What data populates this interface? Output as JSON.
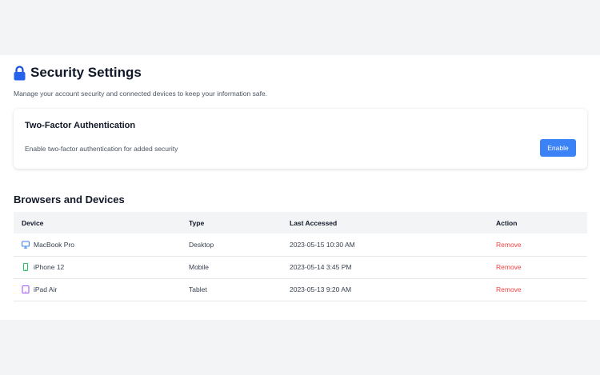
{
  "page": {
    "title": "Security Settings",
    "subtitle": "Manage your account security and connected devices to keep your information safe."
  },
  "two_factor": {
    "title": "Two-Factor Authentication",
    "description": "Enable two-factor authentication for added security",
    "button_label": "Enable"
  },
  "devices_section": {
    "title": "Browsers and Devices",
    "columns": [
      "Device",
      "Type",
      "Last Accessed",
      "Action"
    ],
    "rows": [
      {
        "device": "MacBook Pro",
        "icon": "desktop-icon",
        "type": "Desktop",
        "last_accessed": "2023-05-15 10:30 AM",
        "action": "Remove"
      },
      {
        "device": "iPhone 12",
        "icon": "mobile-icon",
        "type": "Mobile",
        "last_accessed": "2023-05-14 3:45 PM",
        "action": "Remove"
      },
      {
        "device": "iPad Air",
        "icon": "tablet-icon",
        "type": "Tablet",
        "last_accessed": "2023-05-13 9:20 AM",
        "action": "Remove"
      }
    ]
  },
  "colors": {
    "accent": "#3b82f6",
    "danger": "#ef4444",
    "desktop_icon": "#3b82f6",
    "mobile_icon": "#22c55e",
    "tablet_icon": "#a855f7"
  }
}
